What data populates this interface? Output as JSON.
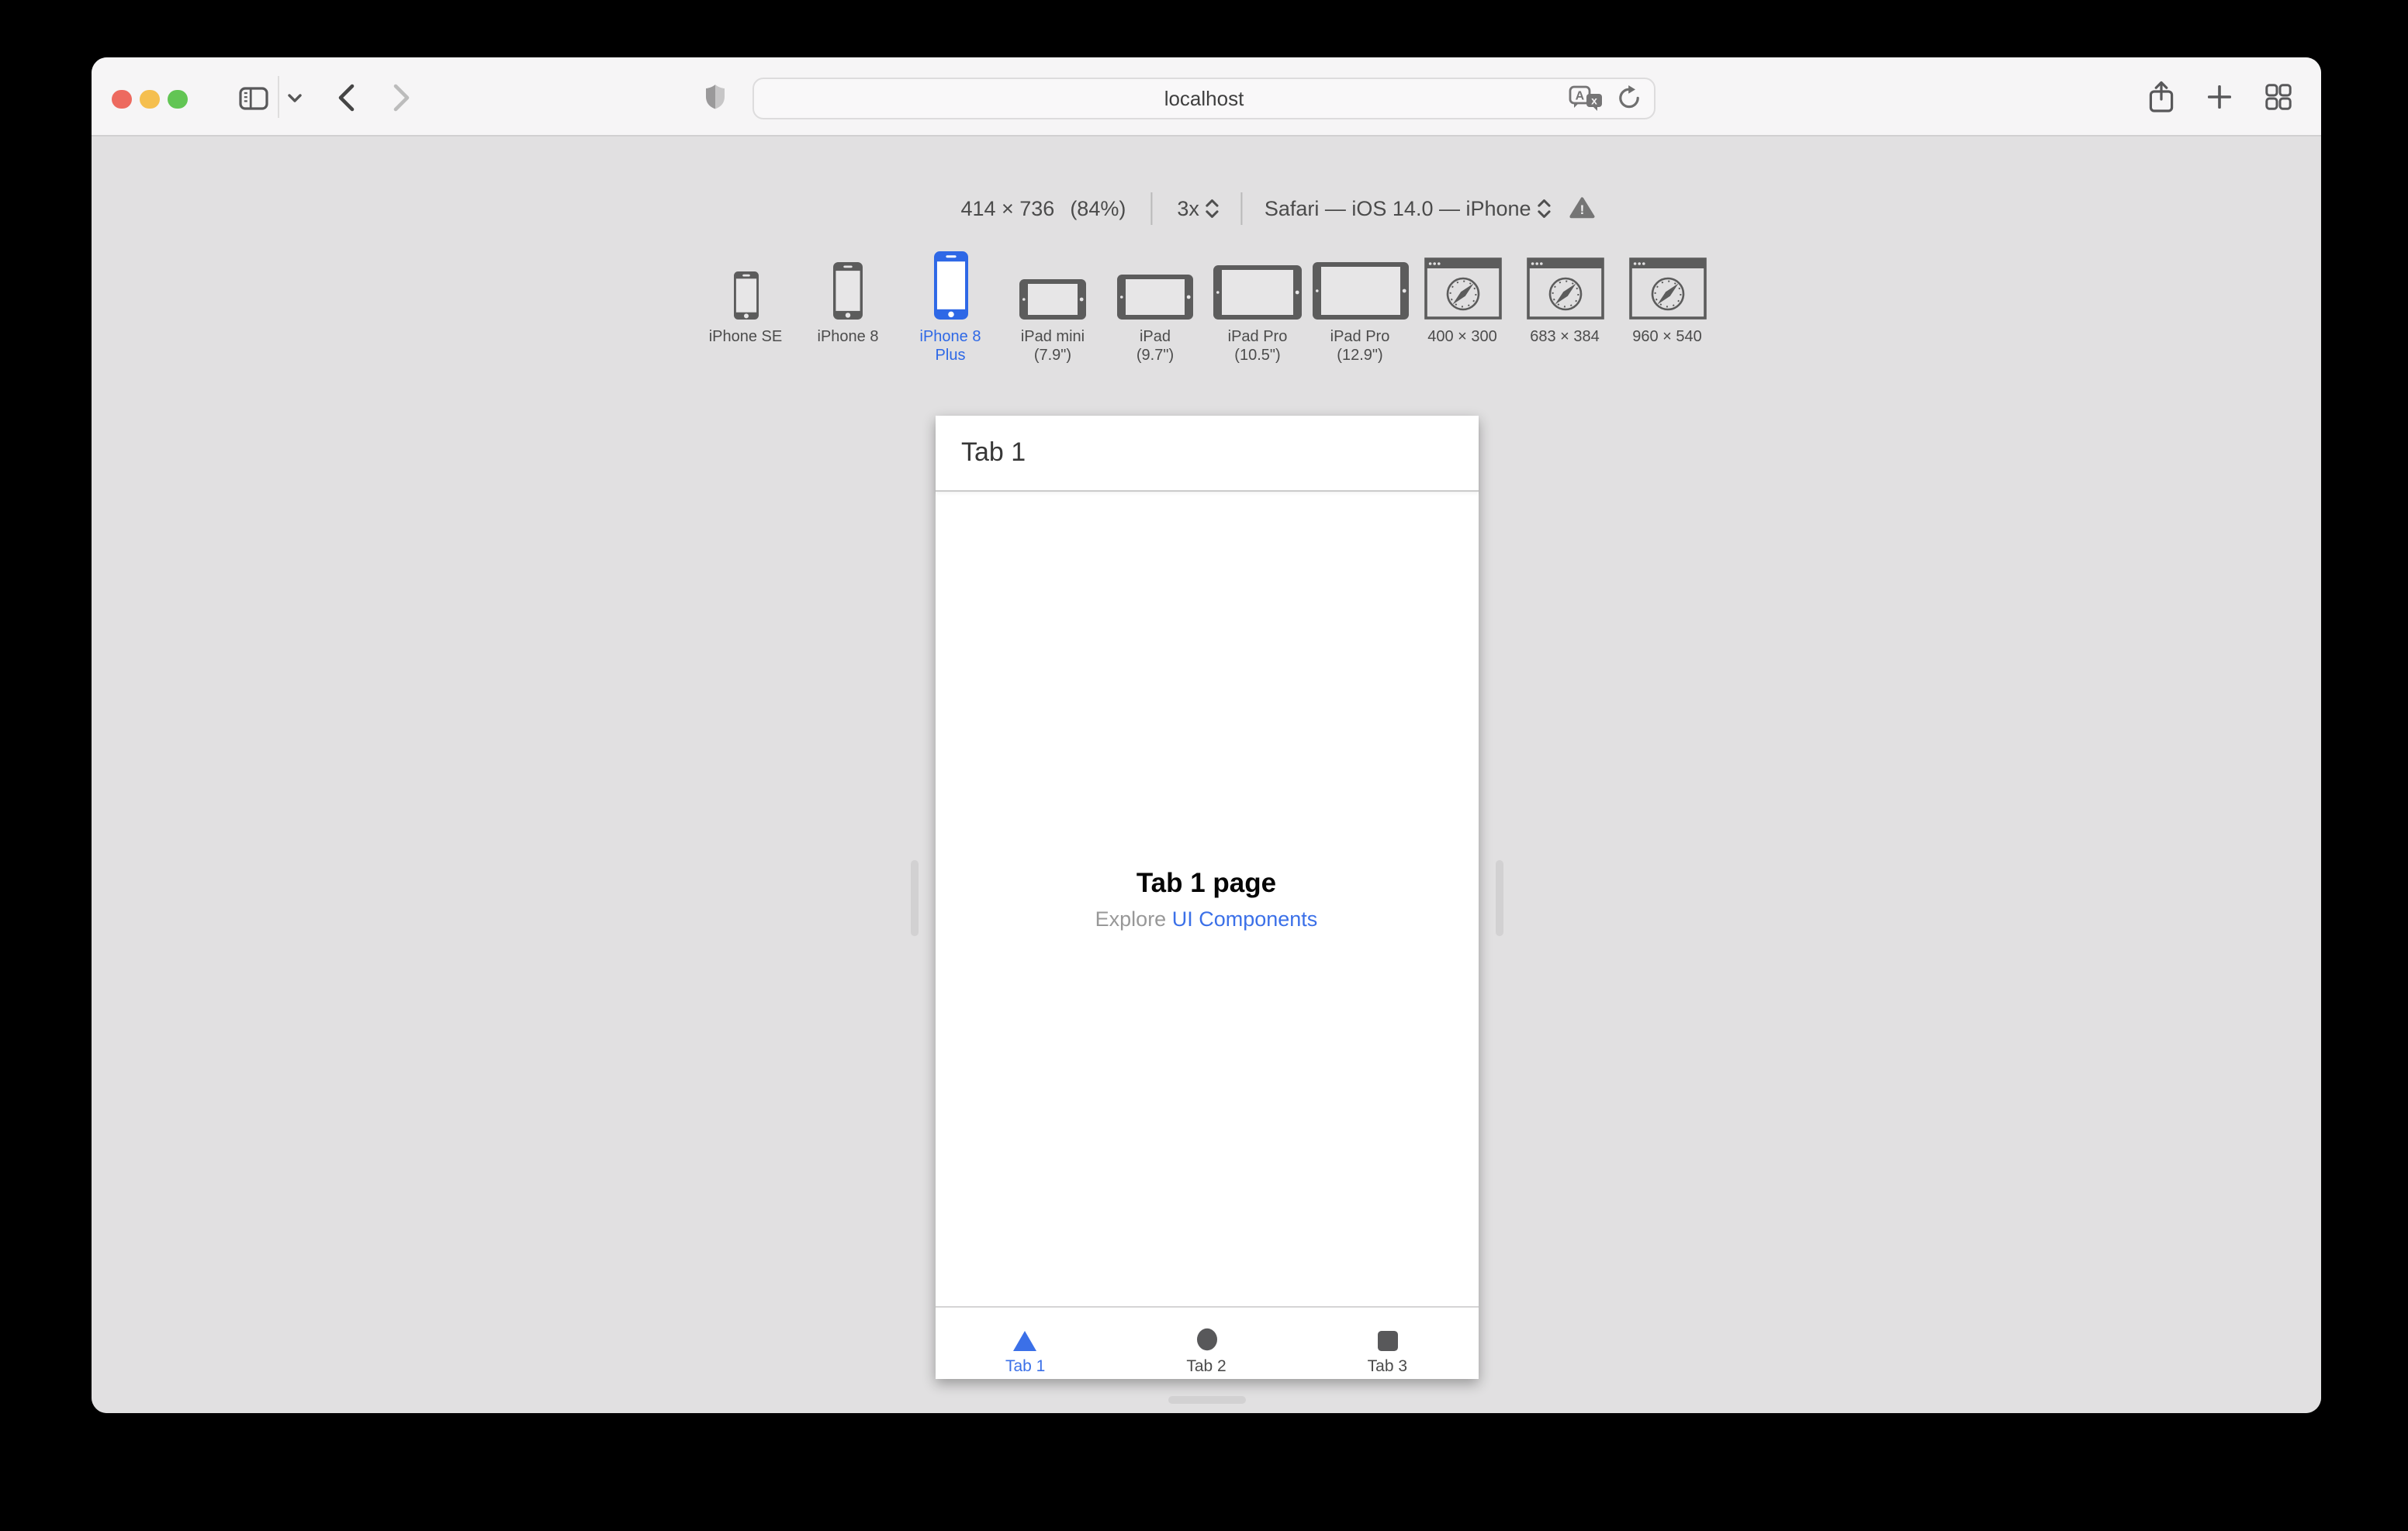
{
  "browser": {
    "url": "localhost",
    "icons": [
      "close",
      "minimize",
      "zoom",
      "sidebar",
      "chevron-down",
      "back",
      "forward",
      "privacy-shield",
      "translate",
      "reload",
      "share",
      "new-tab",
      "tab-overview"
    ]
  },
  "rdm": {
    "size_label": "414 × 736",
    "zoom_label": "(84%)",
    "scale_label": "3x",
    "ua_label": "Safari — iOS 14.0 — iPhone",
    "devices": [
      {
        "label_lines": [
          "iPhone SE"
        ],
        "type": "phone",
        "w": 16,
        "h": 31,
        "selected": false
      },
      {
        "label_lines": [
          "iPhone 8"
        ],
        "type": "phone",
        "w": 19,
        "h": 37,
        "selected": false
      },
      {
        "label_lines": [
          "iPhone 8",
          "Plus"
        ],
        "type": "phone",
        "w": 22,
        "h": 44,
        "selected": true
      },
      {
        "label_lines": [
          "iPad mini",
          "(7.9\")"
        ],
        "type": "tablet",
        "w": 43,
        "h": 26,
        "selected": false
      },
      {
        "label_lines": [
          "iPad",
          "(9.7\")"
        ],
        "type": "tablet",
        "w": 49,
        "h": 29,
        "selected": false
      },
      {
        "label_lines": [
          "iPad Pro",
          "(10.5\")"
        ],
        "type": "tablet",
        "w": 57,
        "h": 35,
        "selected": false
      },
      {
        "label_lines": [
          "iPad Pro",
          "(12.9\")"
        ],
        "type": "tablet",
        "w": 62,
        "h": 37,
        "selected": false
      },
      {
        "label_lines": [
          "400 × 300"
        ],
        "type": "browser",
        "w": 50,
        "h": 40,
        "selected": false
      },
      {
        "label_lines": [
          "683 × 384"
        ],
        "type": "browser",
        "w": 50,
        "h": 40,
        "selected": false
      },
      {
        "label_lines": [
          "960 × 540"
        ],
        "type": "browser",
        "w": 50,
        "h": 40,
        "selected": false
      }
    ]
  },
  "preview": {
    "nav_title": "Tab 1",
    "page_title": "Tab 1 page",
    "subtitle_prefix": "Explore ",
    "subtitle_link": "UI Components",
    "tabs": [
      {
        "label": "Tab 1",
        "icon": "triangle",
        "active": true
      },
      {
        "label": "Tab 2",
        "icon": "circle",
        "active": false
      },
      {
        "label": "Tab 3",
        "icon": "square",
        "active": false
      }
    ]
  },
  "colors": {
    "accent_blue": "#2e68e6",
    "link_blue": "#3b70e8",
    "icon_gray": "#5c5c5c",
    "screen_gray": "#e7e6e7",
    "traffic_red": "#ED6A5F",
    "traffic_yellow": "#F5BF4F",
    "traffic_green": "#62C554"
  }
}
